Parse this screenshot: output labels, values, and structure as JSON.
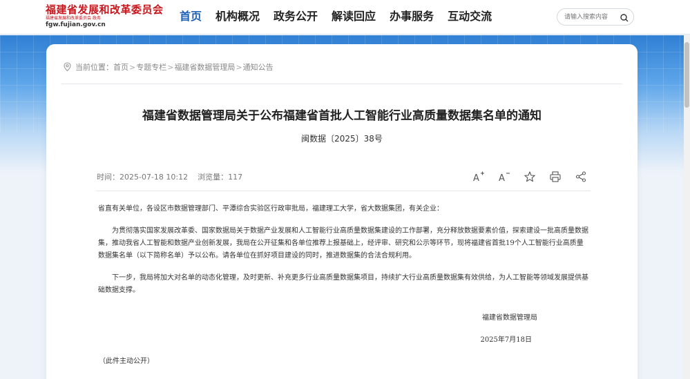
{
  "site": {
    "title": "福建省发展和改革委员会",
    "subtitle": "福建省发展和改革委员会 政务",
    "url": "fgw.fujian.gov.cn"
  },
  "nav": {
    "items": [
      "首页",
      "机构概况",
      "政务公开",
      "解读回应",
      "办事服务",
      "互动交流"
    ],
    "active": "首页"
  },
  "search": {
    "placeholder": "请输入搜索内容",
    "icon": "search-icon"
  },
  "breadcrumb": {
    "label": "当前位置：",
    "items": [
      "首页",
      "专题专栏",
      "福建省数据管理局",
      "通知公告"
    ],
    "separator": ">"
  },
  "article": {
    "title": "福建省数据管理局关于公布福建省首批人工智能行业高质量数据集名单的通知",
    "doc_number": "闽数据〔2025〕38号",
    "time_label": "时间：",
    "time": "2025-07-18 10:12",
    "views_label": "浏览量：",
    "views": "117",
    "salutation": "省直有关单位，各设区市数据管理部门、平潭综合实验区行政审批局，福建理工大学，省大数据集团，有关企业：",
    "para1": "为贯彻落实国家发展改革委、国家数据局关于数据产业发展和人工智能行业高质量数据集建设的工作部署，充分释放数据要素价值，探索建设一批高质量数据集，推动我省人工智能和数据产业创新发展，我局在公开征集和各单位推荐上报基础上，经评审、研究和公示等环节，现将福建省首批19个人工智能行业高质量数据集名单（以下简称名单）予以公布。请各单位在抓好项目建设的同时，推进数据集的合法合规利用。",
    "para2": "下一步，我局将加大对名单的动态化管理，及时更新、补充更多行业高质量数据集项目，持续扩大行业高质量数据集有效供给，为人工智能等领域发展提供基础数据支撑。",
    "signature": "福建省数据管理局",
    "date": "2025年7月18日",
    "note": "（此件主动公开）"
  },
  "tools": {
    "font_increase": "A+",
    "font_decrease": "A−"
  },
  "colors": {
    "brand_red": "#c8161d",
    "nav_active": "#1a5fb4"
  }
}
